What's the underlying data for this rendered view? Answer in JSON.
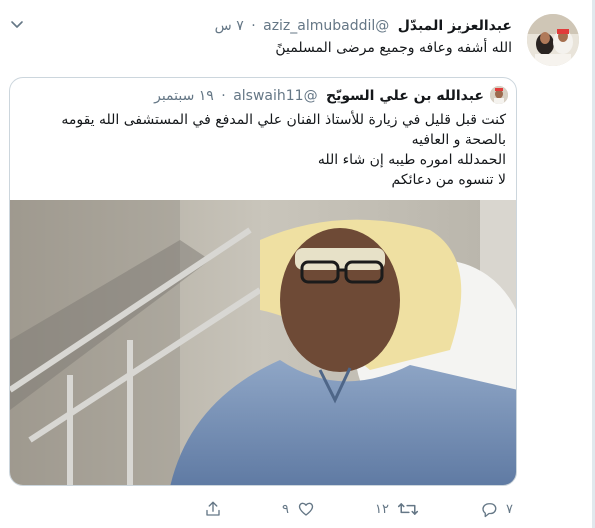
{
  "tweet": {
    "author_name": "عبدالعزيز المبدّل",
    "handle": "@aziz_almubaddil",
    "dot": "·",
    "time": "٧ س",
    "text": "الله أشفه وعافه وجميع مرضى المسلمينً"
  },
  "quoted": {
    "author_name": "عبدالله بن علي السويّح",
    "handle": "@alswaih11",
    "dot": "·",
    "time": "١٩ سبتمبر",
    "lines": [
      "كنت قبل قليل في زيارة للأستاذ الفنان علي المدفع في المستشفى الله يقومه",
      "بالصحة و العافيه",
      "الحمدلله اموره طيبه إن شاء الله",
      "لا تنسوه من دعائكم"
    ]
  },
  "actions": {
    "reply_count": "٧",
    "retweet_count": "١٢",
    "like_count": "٩"
  },
  "colors": {
    "secondary_text": "#657786",
    "border": "#ccd6dd",
    "icon": "#657786"
  },
  "icons": {
    "more": "chevron-down-icon",
    "reply": "reply-icon",
    "retweet": "retweet-icon",
    "like": "heart-icon",
    "share": "share-icon"
  }
}
